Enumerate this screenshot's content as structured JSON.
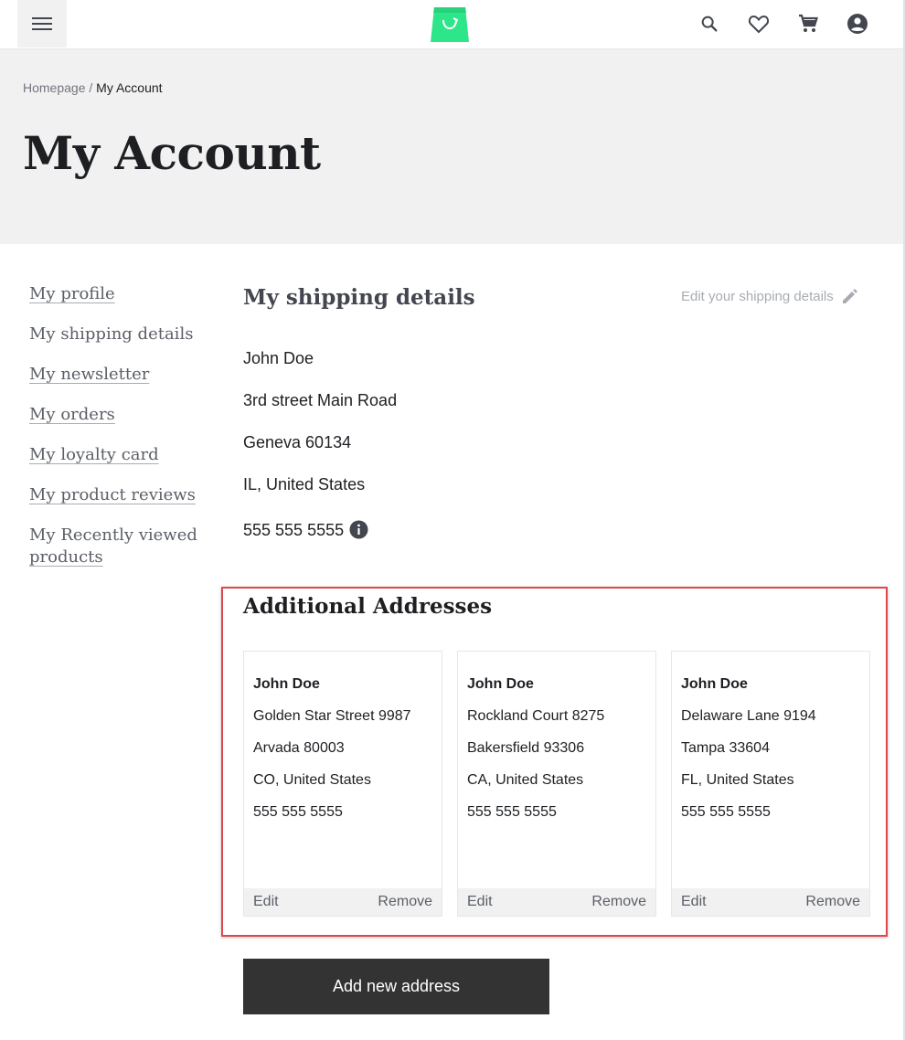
{
  "header": {
    "menu_icon": "hamburger-menu-icon",
    "logo_icon": "shopping-bag-logo",
    "icons": [
      "search-icon",
      "heart-icon",
      "cart-icon",
      "account-icon"
    ],
    "brand_color": "#2ee68a"
  },
  "breadcrumb": {
    "home": "Homepage",
    "separator": " / ",
    "current": "My Account"
  },
  "page_title": "My Account",
  "sidebar": {
    "items": [
      {
        "label": "My profile"
      },
      {
        "label": "My shipping details"
      },
      {
        "label": "My newsletter"
      },
      {
        "label": "My orders"
      },
      {
        "label": "My loyalty card"
      },
      {
        "label": "My product reviews"
      },
      {
        "label_line1": "My Recently viewed",
        "label_line2": "products"
      }
    ]
  },
  "shipping": {
    "title": "My shipping details",
    "edit_label": "Edit your shipping details",
    "name": "John Doe",
    "street": "3rd street Main Road",
    "city": "Geneva 60134",
    "region": "IL, United States",
    "phone": "555 555 5555"
  },
  "additional": {
    "title": "Additional Addresses",
    "cards": [
      {
        "name": "John Doe",
        "street": "Golden Star Street 9987",
        "city": "Arvada 80003",
        "region": "CO, United States",
        "phone": "555 555 5555",
        "edit": "Edit",
        "remove": "Remove"
      },
      {
        "name": "John Doe",
        "street": "Rockland Court 8275",
        "city": "Bakersfield 93306",
        "region": "CA, United States",
        "phone": "555 555 5555",
        "edit": "Edit",
        "remove": "Remove"
      },
      {
        "name": "John Doe",
        "street": "Delaware Lane 9194",
        "city": "Tampa 33604",
        "region": "FL, United States",
        "phone": "555 555 5555",
        "edit": "Edit",
        "remove": "Remove"
      }
    ],
    "add_button": "Add new address",
    "highlight_color": "#e0474c"
  }
}
